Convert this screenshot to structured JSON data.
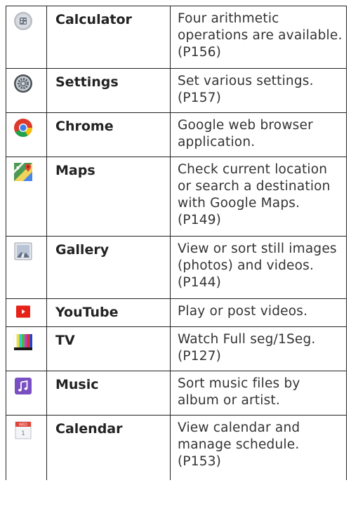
{
  "apps": [
    {
      "id": "calculator",
      "name": "Calculator",
      "description": "Four arithmetic operations are available. (P156)"
    },
    {
      "id": "settings",
      "name": "Settings",
      "description": "Set various settings. (P157)"
    },
    {
      "id": "chrome",
      "name": "Chrome",
      "description": "Google web browser application."
    },
    {
      "id": "maps",
      "name": "Maps",
      "description": "Check current location or search a destination with Google Maps. (P149)"
    },
    {
      "id": "gallery",
      "name": "Gallery",
      "description": "View or sort still images (photos) and videos. (P144)"
    },
    {
      "id": "youtube",
      "name": "YouTube",
      "description": "Play or post videos."
    },
    {
      "id": "tv",
      "name": "TV",
      "description": "Watch Full seg/1Seg. (P127)"
    },
    {
      "id": "music",
      "name": "Music",
      "description": "Sort music files by album or artist."
    },
    {
      "id": "calendar",
      "name": "Calendar",
      "description": "View calendar and manage schedule. (P153)"
    }
  ],
  "icons": {
    "calendar_badge": "WED",
    "calendar_day": "1"
  },
  "colors": {
    "border": "#222222",
    "youtube_red": "#e62117",
    "music_purple": "#7a4fc4"
  }
}
